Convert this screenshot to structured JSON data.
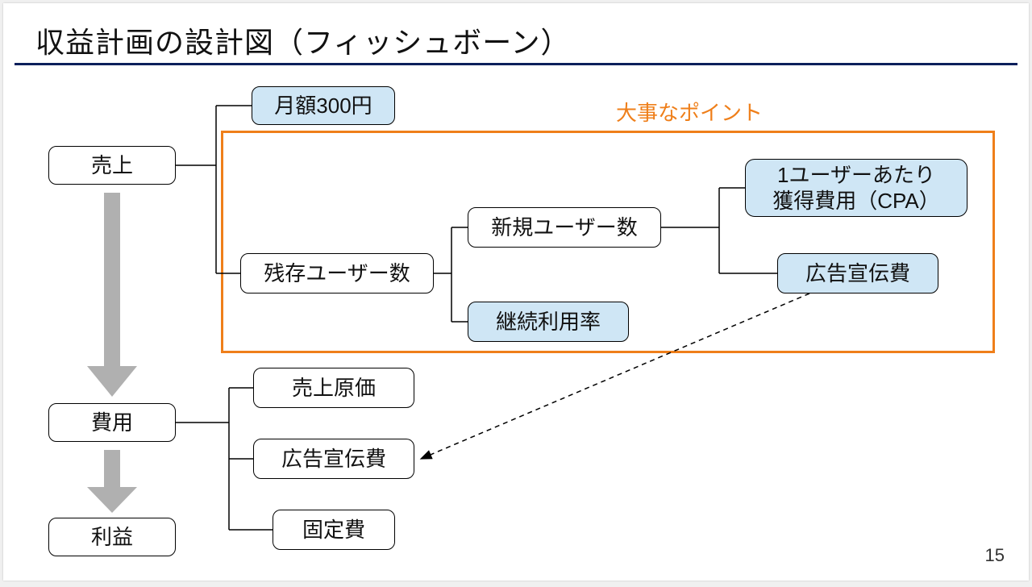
{
  "title": "収益計画の設計図（フィッシュボーン）",
  "highlight_label": "大事なポイント",
  "nodes": {
    "sales": "売上",
    "monthly_price": "月額300円",
    "remaining_users": "残存ユーザー数",
    "new_users": "新規ユーザー数",
    "retention_rate": "継続利用率",
    "cpa": "1ユーザーあたり\n獲得費用（CPA）",
    "ad_cost_top": "広告宣伝費",
    "cost": "費用",
    "cogs": "売上原価",
    "ad_cost_bottom": "広告宣伝費",
    "fixed_cost": "固定費",
    "profit": "利益"
  },
  "page_number": "15"
}
